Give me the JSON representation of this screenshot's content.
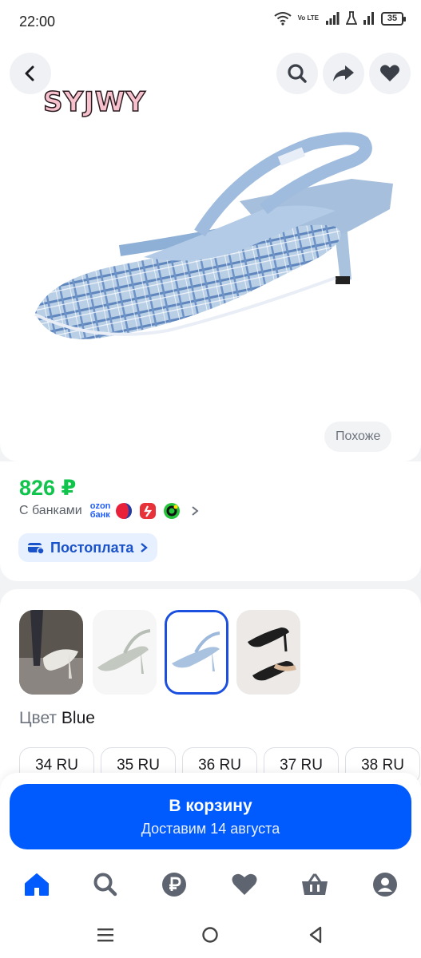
{
  "status_bar": {
    "time": "22:00",
    "network": "Vo LTE",
    "battery": "35"
  },
  "product": {
    "image_logo": "SYJWY",
    "similar_label": "Похоже",
    "icons": {
      "back": "chevron-left-icon",
      "search": "search-icon",
      "share": "share-icon",
      "favorite": "heart-icon"
    }
  },
  "pricing": {
    "price": "826 ₽",
    "banks_label": "С банками",
    "ozon_bank": [
      "ozon",
      "банк"
    ],
    "postpay_label": "Постоплата"
  },
  "variants": {
    "color_label": "Цвет",
    "color_value": "Blue",
    "selected_index": 2,
    "sizes": [
      "34 RU",
      "35 RU",
      "36 RU",
      "37 RU",
      "38 RU"
    ]
  },
  "cart": {
    "title": "В корзину",
    "subtitle": "Доставим 14 августа"
  },
  "colors": {
    "accent": "#005bff",
    "price_green": "#10c44c",
    "postpay_bg": "#e6f0ff",
    "postpay_text": "#1a52c9"
  },
  "bottom_nav": [
    "home-icon",
    "search-icon",
    "ruble-icon",
    "heart-icon",
    "basket-icon",
    "profile-icon"
  ],
  "system_nav": [
    "menu-icon",
    "home-circle-icon",
    "back-triangle-icon"
  ]
}
